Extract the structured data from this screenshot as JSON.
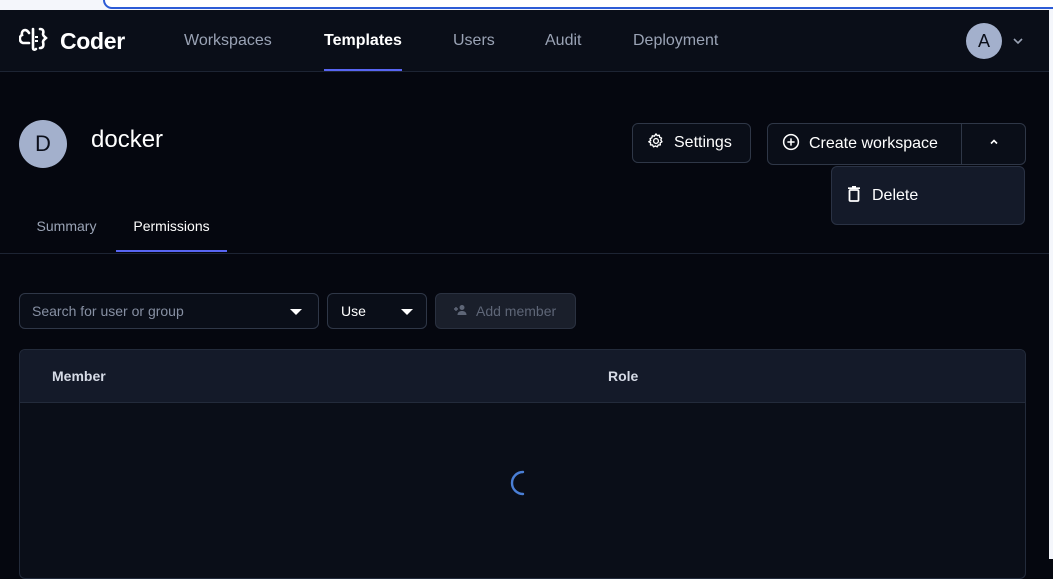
{
  "app": {
    "name": "Coder"
  },
  "nav": {
    "items": [
      {
        "label": "Workspaces",
        "active": false
      },
      {
        "label": "Templates",
        "active": true
      },
      {
        "label": "Users",
        "active": false
      },
      {
        "label": "Audit",
        "active": false
      },
      {
        "label": "Deployment",
        "active": false
      }
    ],
    "user_initial": "A"
  },
  "template": {
    "avatar_initial": "D",
    "name": "docker",
    "settings_label": "Settings",
    "create_label": "Create workspace",
    "menu": {
      "delete_label": "Delete"
    }
  },
  "tabs": [
    {
      "label": "Summary",
      "active": false
    },
    {
      "label": "Permissions",
      "active": true
    }
  ],
  "permissions": {
    "search_placeholder": "Search for user or group",
    "role_value": "Use",
    "add_member_label": "Add member",
    "columns": [
      "Member",
      "Role"
    ],
    "loading": true
  },
  "colors": {
    "accent": "#5865f2",
    "background": "#05070f",
    "spinner": "#4a7fd6"
  },
  "icons": {
    "logo": "coder-logo-icon",
    "settings": "gear-icon",
    "create": "plus-circle-icon",
    "split": "chevron-up-icon",
    "delete": "trash-icon",
    "add_member": "person-add-icon",
    "user_menu": "chevron-down-icon"
  }
}
